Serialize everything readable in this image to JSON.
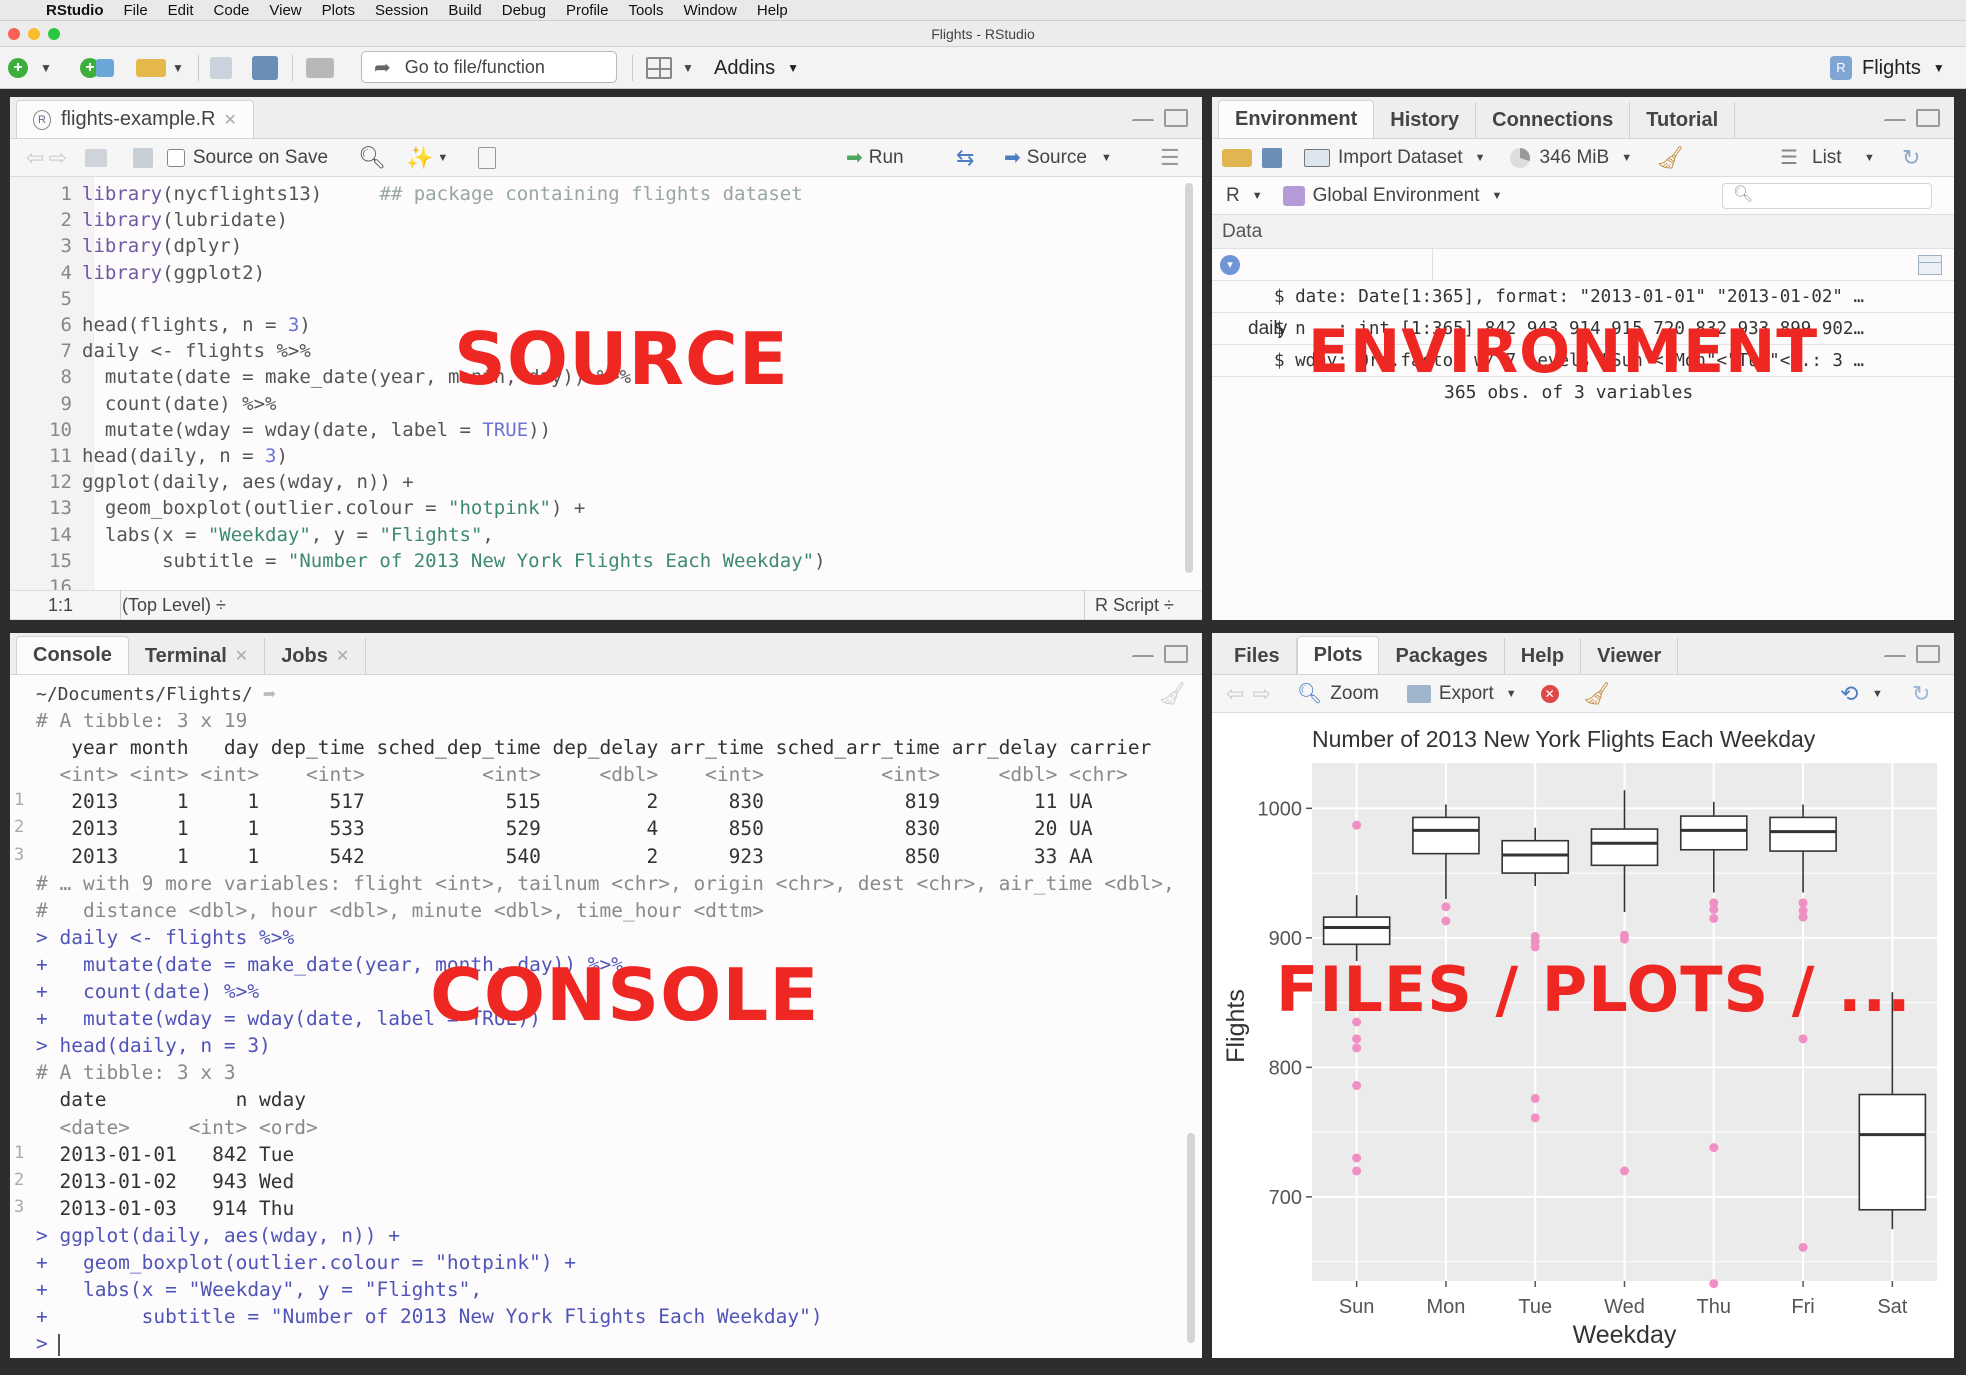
{
  "menubar": {
    "apple": "",
    "app": "RStudio",
    "items": [
      "File",
      "Edit",
      "Code",
      "View",
      "Plots",
      "Session",
      "Build",
      "Debug",
      "Profile",
      "Tools",
      "Window",
      "Help"
    ]
  },
  "window": {
    "title": "Flights - RStudio"
  },
  "toolbar": {
    "goto": "Go to file/function",
    "addins": "Addins",
    "project": "Flights"
  },
  "source": {
    "tab": "flights-example.R",
    "source_on_save": "Source on Save",
    "run": "Run",
    "source_btn": "Source",
    "lines": [
      [
        {
          "t": "library",
          "c": "fn"
        },
        {
          "t": "(nycflights13)",
          "c": "pl"
        },
        {
          "t": "     ## package containing flights dataset",
          "c": "cm"
        }
      ],
      [
        {
          "t": "library",
          "c": "fn"
        },
        {
          "t": "(lubridate)",
          "c": "pl"
        }
      ],
      [
        {
          "t": "library",
          "c": "fn"
        },
        {
          "t": "(dplyr)",
          "c": "pl"
        }
      ],
      [
        {
          "t": "library",
          "c": "fn"
        },
        {
          "t": "(ggplot2)",
          "c": "pl"
        }
      ],
      [],
      [
        {
          "t": "head(flights, n = ",
          "c": "pl"
        },
        {
          "t": "3",
          "c": "kw"
        },
        {
          "t": ")",
          "c": "pl"
        }
      ],
      [
        {
          "t": "daily <- flights %>%",
          "c": "pl"
        }
      ],
      [
        {
          "t": "  mutate(date = make_date(year, month, day)) %>%",
          "c": "pl"
        }
      ],
      [
        {
          "t": "  count(date) %>%",
          "c": "pl"
        }
      ],
      [
        {
          "t": "  mutate(wday = wday(date, label = ",
          "c": "pl"
        },
        {
          "t": "TRUE",
          "c": "kw"
        },
        {
          "t": "))",
          "c": "pl"
        }
      ],
      [
        {
          "t": "head(daily, n = ",
          "c": "pl"
        },
        {
          "t": "3",
          "c": "kw"
        },
        {
          "t": ")",
          "c": "pl"
        }
      ],
      [
        {
          "t": "ggplot(daily, aes(wday, n)) +",
          "c": "pl"
        }
      ],
      [
        {
          "t": "  geom_boxplot(outlier.colour = ",
          "c": "pl"
        },
        {
          "t": "\"hotpink\"",
          "c": "st"
        },
        {
          "t": ") +",
          "c": "pl"
        }
      ],
      [
        {
          "t": "  labs(x = ",
          "c": "pl"
        },
        {
          "t": "\"Weekday\"",
          "c": "st"
        },
        {
          "t": ", y = ",
          "c": "pl"
        },
        {
          "t": "\"Flights\"",
          "c": "st"
        },
        {
          "t": ",",
          "c": "pl"
        }
      ],
      [
        {
          "t": "       subtitle = ",
          "c": "pl"
        },
        {
          "t": "\"Number of 2013 New York Flights Each Weekday\"",
          "c": "st"
        },
        {
          "t": ")",
          "c": "pl"
        }
      ],
      []
    ],
    "status_pos": "1:1",
    "status_scope": "(Top Level) ÷",
    "status_type": "R Script ÷",
    "overlay": "SOURCE"
  },
  "environment": {
    "tabs": [
      "Environment",
      "History",
      "Connections",
      "Tutorial"
    ],
    "import": "Import Dataset",
    "memory": "346 MiB",
    "list": "List",
    "lang": "R",
    "scope": "Global Environment",
    "section": "Data",
    "object_name": "daily",
    "object_desc": "365 obs. of 3 variables",
    "details": [
      "$ date: Date[1:365], format: \"2013-01-01\" \"2013-01-02\" …",
      "$ n   : int [1:365] 842 943 914 915 720 832 933 899 902…",
      "$ wday: Ord.factor w/ 7 levels \"Sun\"<\"Mon\"<\"Tue\"<..: 3 …"
    ],
    "overlay": "ENVIRONMENT"
  },
  "console": {
    "tabs": [
      "Console",
      "Terminal",
      "Jobs"
    ],
    "path": "~/Documents/Flights/",
    "lines": [
      {
        "t": "# A tibble: 3 x 19",
        "c": "cgrey"
      },
      {
        "t": "   year month   day dep_time sched_dep_time dep_delay arr_time sched_arr_time arr_delay carrier",
        "c": ""
      },
      {
        "t": "  <int> <int> <int>    <int>          <int>     <dbl>    <int>          <int>     <dbl> <chr>",
        "c": "cgrey"
      },
      {
        "t": "   2013     1     1      517            515         2      830            819        11 UA",
        "c": "",
        "n": "1"
      },
      {
        "t": "   2013     1     1      533            529         4      850            830        20 UA",
        "c": "",
        "n": "2"
      },
      {
        "t": "   2013     1     1      542            540         2      923            850        33 AA",
        "c": "",
        "n": "3"
      },
      {
        "t": "# … with 9 more variables: flight <int>, tailnum <chr>, origin <chr>, dest <chr>, air_time <dbl>,",
        "c": "cgrey"
      },
      {
        "t": "#   distance <dbl>, hour <dbl>, minute <dbl>, time_hour <dttm>",
        "c": "cgrey"
      },
      {
        "t": "> daily <- flights %>%",
        "c": "cblue"
      },
      {
        "t": "+   mutate(date = make_date(year, month, day)) %>%",
        "c": "cblue"
      },
      {
        "t": "+   count(date) %>%",
        "c": "cblue"
      },
      {
        "t": "+   mutate(wday = wday(date, label = TRUE))",
        "c": "cblue"
      },
      {
        "t": "> head(daily, n = 3)",
        "c": "cblue"
      },
      {
        "t": "# A tibble: 3 x 3",
        "c": "cgrey"
      },
      {
        "t": "  date           n wday",
        "c": ""
      },
      {
        "t": "  <date>     <int> <ord>",
        "c": "cgrey"
      },
      {
        "t": "  2013-01-01   842 Tue",
        "c": "",
        "n": "1"
      },
      {
        "t": "  2013-01-02   943 Wed",
        "c": "",
        "n": "2"
      },
      {
        "t": "  2013-01-03   914 Thu",
        "c": "",
        "n": "3"
      },
      {
        "t": "> ggplot(daily, aes(wday, n)) +",
        "c": "cblue"
      },
      {
        "t": "+   geom_boxplot(outlier.colour = \"hotpink\") +",
        "c": "cblue"
      },
      {
        "t": "+   labs(x = \"Weekday\", y = \"Flights\",",
        "c": "cblue"
      },
      {
        "t": "+        subtitle = \"Number of 2013 New York Flights Each Weekday\")",
        "c": "cblue"
      },
      {
        "t": "> ",
        "c": "cblue"
      }
    ],
    "overlay": "CONSOLE"
  },
  "files": {
    "tabs": [
      "Files",
      "Plots",
      "Packages",
      "Help",
      "Viewer"
    ],
    "zoom": "Zoom",
    "export": "Export",
    "overlay": "FILES / PLOTS / ..."
  },
  "chart_data": {
    "type": "box",
    "title": "Number of 2013 New York Flights Each Weekday",
    "xlabel": "Weekday",
    "ylabel": "Flights",
    "ylim": [
      635,
      1035
    ],
    "yticks": [
      700,
      800,
      900,
      1000
    ],
    "categories": [
      "Sun",
      "Mon",
      "Tue",
      "Wed",
      "Thu",
      "Fri",
      "Sat"
    ],
    "boxes": [
      {
        "lower": 882,
        "q1": 895,
        "median": 908,
        "q3": 916,
        "upper": 933
      },
      {
        "lower": 930,
        "q1": 965,
        "median": 983,
        "q3": 993,
        "upper": 1003
      },
      {
        "lower": 940,
        "q1": 950,
        "median": 964,
        "q3": 975,
        "upper": 985
      },
      {
        "lower": 920,
        "q1": 956,
        "median": 973,
        "q3": 984,
        "upper": 1014
      },
      {
        "lower": 935,
        "q1": 968,
        "median": 983,
        "q3": 994,
        "upper": 1005
      },
      {
        "lower": 935,
        "q1": 967,
        "median": 982,
        "q3": 993,
        "upper": 1003
      },
      {
        "lower": 675,
        "q1": 690,
        "median": 748,
        "q3": 779,
        "upper": 858
      }
    ],
    "outliers": [
      [
        987,
        835,
        822,
        815,
        786,
        730,
        720
      ],
      [
        924,
        913
      ],
      [
        901,
        897,
        893,
        776,
        761
      ],
      [
        902,
        899,
        720
      ],
      [
        927,
        922,
        915,
        738,
        633
      ],
      [
        927,
        921,
        916,
        822,
        661
      ],
      []
    ],
    "outlier_color": "#f08fc3",
    "panel_color": "#ebebeb",
    "grid": true
  }
}
